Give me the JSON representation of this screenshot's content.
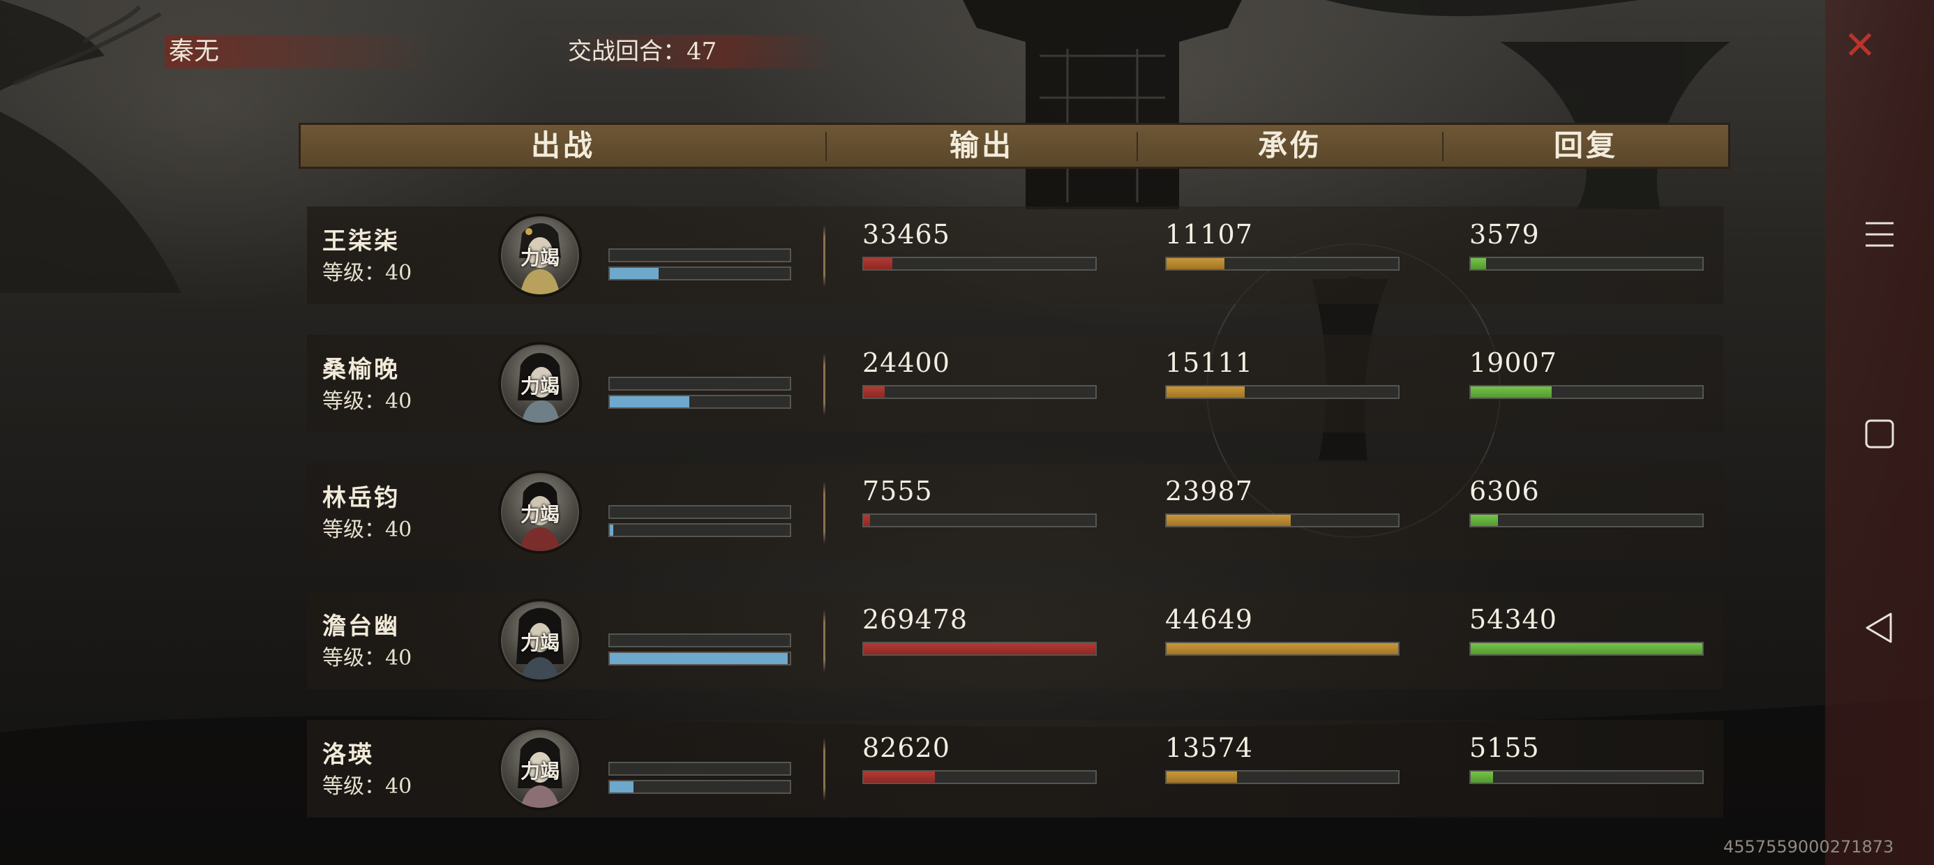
{
  "player": {
    "name": "秦无"
  },
  "battle": {
    "round_label": "交战回合：47"
  },
  "header": {
    "col_deploy": "出战",
    "col_output": "输出",
    "col_taken": "承伤",
    "col_heal": "回复"
  },
  "avatar_tag": "力竭",
  "colors": {
    "output": "#b33a35",
    "taken": "#c8983b",
    "heal": "#76c34b",
    "hp": "#6ea8cc"
  },
  "heroes": [
    {
      "name": "王柒柒",
      "level": "等级：40",
      "hp_fraction": 0.27,
      "output": "33465",
      "output_fraction": 0.124,
      "taken": "11107",
      "taken_fraction": 0.249,
      "heal": "3579",
      "heal_fraction": 0.066
    },
    {
      "name": "桑榆晚",
      "level": "等级：40",
      "hp_fraction": 0.44,
      "output": "24400",
      "output_fraction": 0.091,
      "taken": "15111",
      "taken_fraction": 0.338,
      "heal": "19007",
      "heal_fraction": 0.35
    },
    {
      "name": "林岳钧",
      "level": "等级：40",
      "hp_fraction": 0.02,
      "output": "7555",
      "output_fraction": 0.028,
      "taken": "23987",
      "taken_fraction": 0.537,
      "heal": "6306",
      "heal_fraction": 0.116
    },
    {
      "name": "澹台幽",
      "level": "等级：40",
      "hp_fraction": 0.99,
      "output": "269478",
      "output_fraction": 1.0,
      "taken": "44649",
      "taken_fraction": 1.0,
      "heal": "54340",
      "heal_fraction": 1.0
    },
    {
      "name": "洛瑛",
      "level": "等级：40",
      "hp_fraction": 0.13,
      "output": "82620",
      "output_fraction": 0.307,
      "taken": "13574",
      "taken_fraction": 0.304,
      "heal": "5155",
      "heal_fraction": 0.095
    }
  ],
  "watermark": "4557559000271873",
  "icons": {
    "close": "close-icon",
    "menu": "menu-icon",
    "home": "square-icon",
    "back": "back-triangle-icon"
  },
  "close_glyph": "✕"
}
